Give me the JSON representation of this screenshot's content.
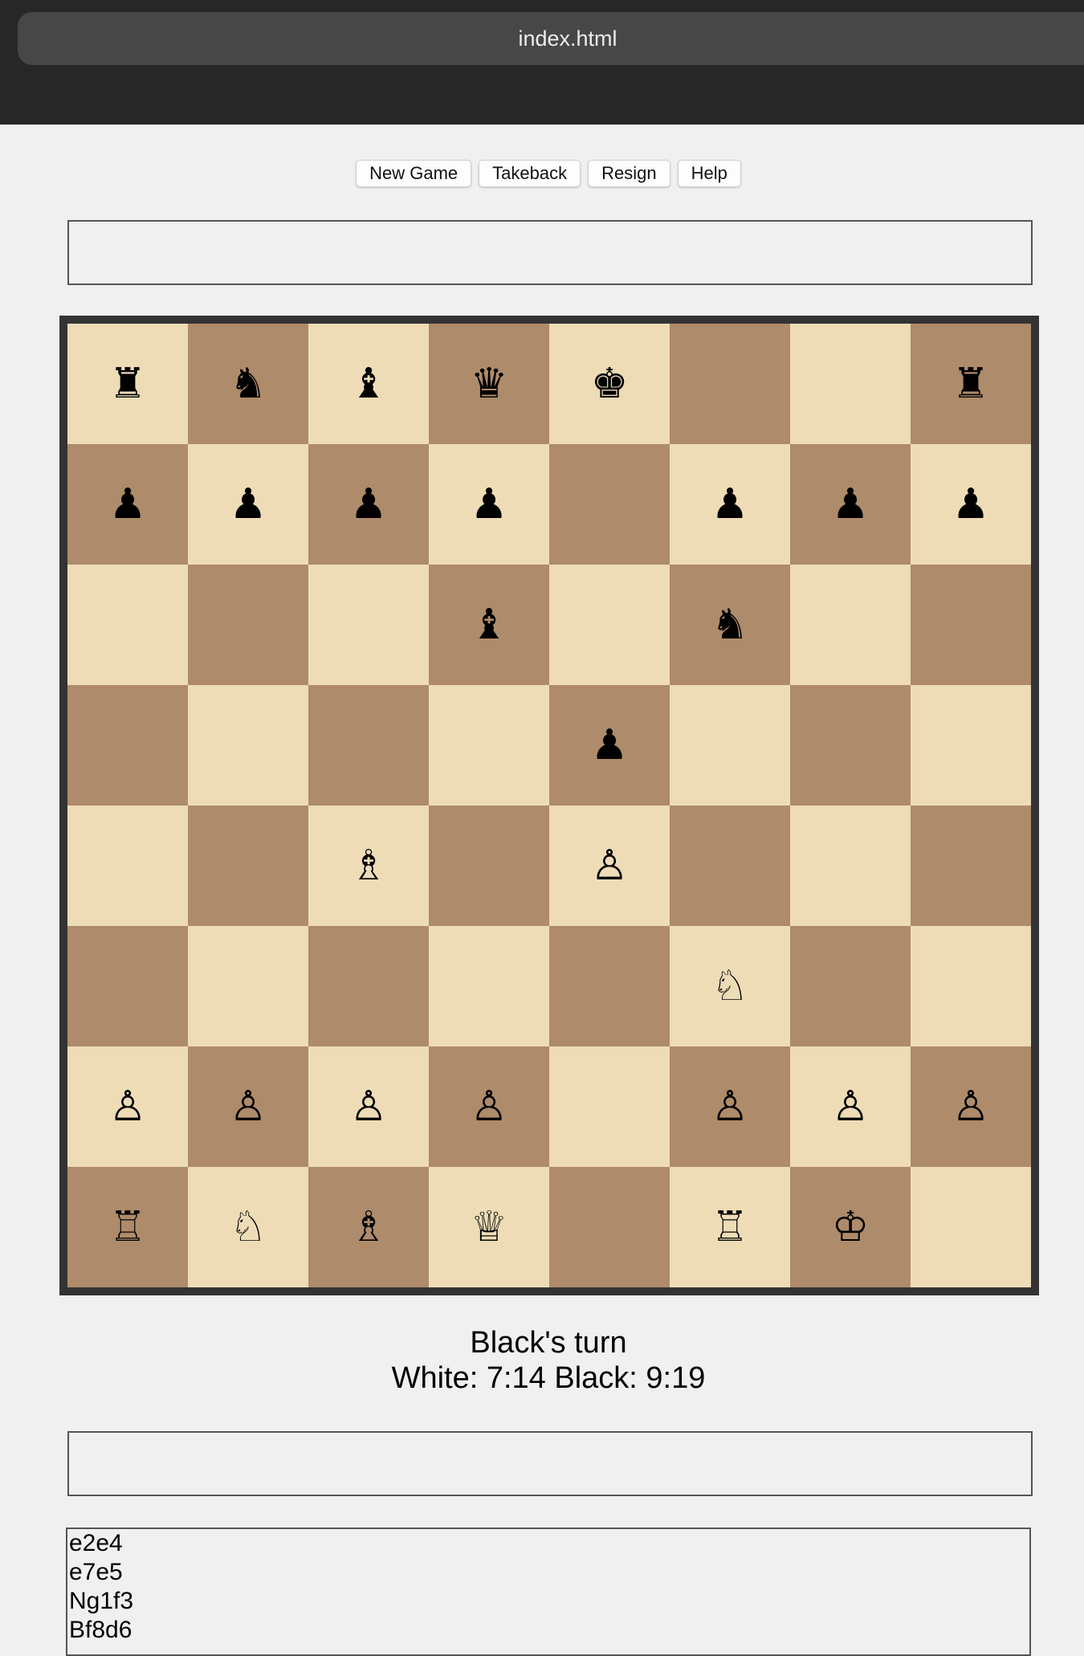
{
  "browser": {
    "tab_title": "index.html"
  },
  "toolbar": {
    "new_game": "New Game",
    "takeback": "Takeback",
    "resign": "Resign",
    "help": "Help"
  },
  "board": {
    "light_color": "#eedcb7",
    "dark_color": "#ae8b6a",
    "ranks": [
      [
        "♜",
        "♞",
        "♝",
        "♛",
        "♚",
        "",
        "",
        "♜"
      ],
      [
        "♟",
        "♟",
        "♟",
        "♟",
        "",
        "♟",
        "♟",
        "♟"
      ],
      [
        "",
        "",
        "",
        "♝",
        "",
        "♞",
        "",
        ""
      ],
      [
        "",
        "",
        "",
        "",
        "♟",
        "",
        "",
        ""
      ],
      [
        "",
        "",
        "♗",
        "",
        "♙",
        "",
        "",
        ""
      ],
      [
        "",
        "",
        "",
        "",
        "",
        "♘",
        "",
        ""
      ],
      [
        "♙",
        "♙",
        "♙",
        "♙",
        "",
        "♙",
        "♙",
        "♙"
      ],
      [
        "♖",
        "♘",
        "♗",
        "♕",
        "",
        "♖",
        "♔",
        ""
      ]
    ]
  },
  "status": {
    "turn": "Black's turn",
    "clock": "White: 7:14 Black: 9:19"
  },
  "moves": [
    "e2e4",
    "e7e5",
    "Ng1f3",
    "Bf8d6"
  ]
}
